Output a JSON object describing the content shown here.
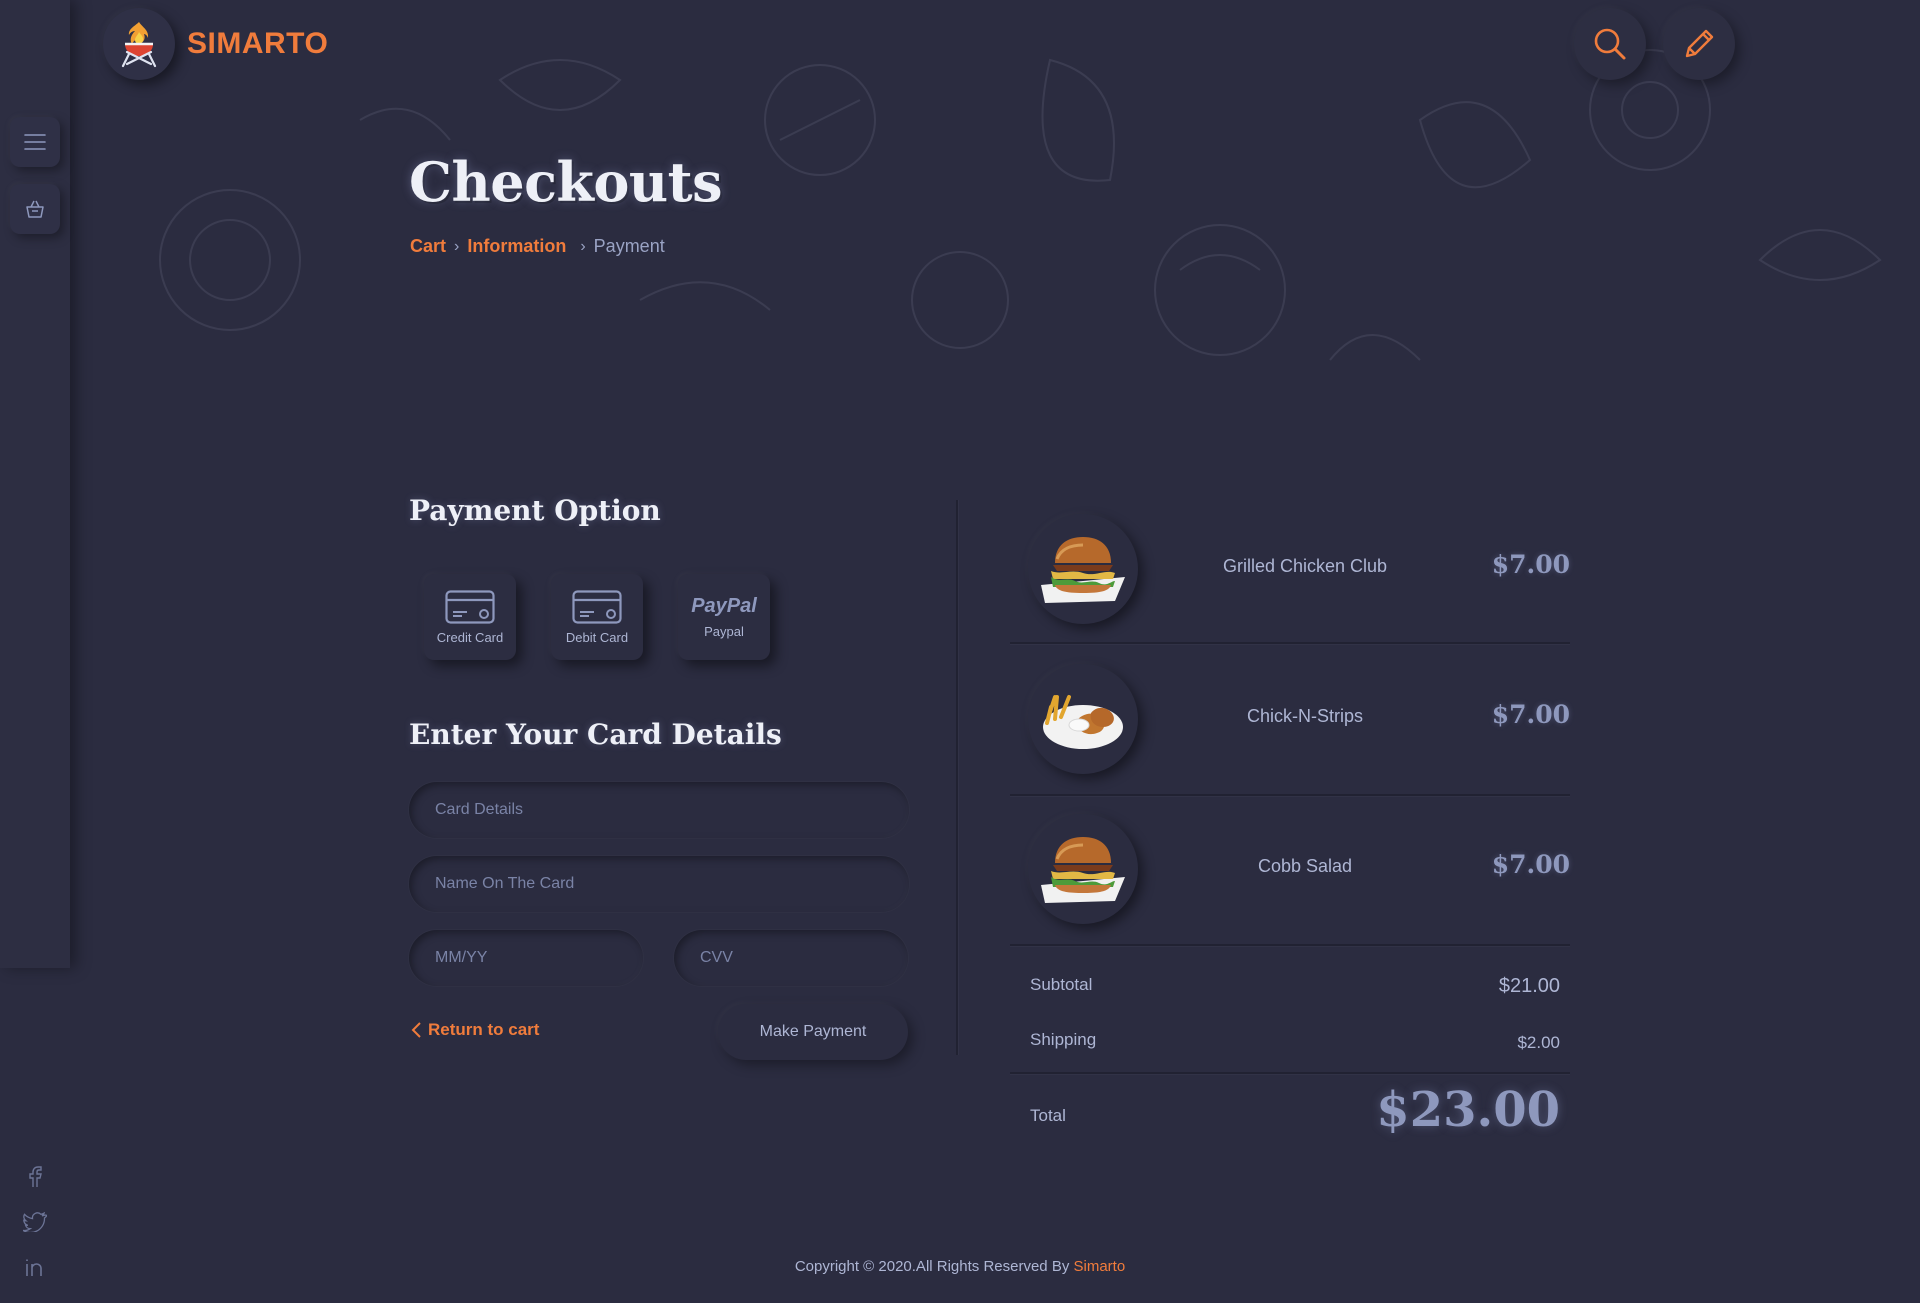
{
  "brand": {
    "name": "SIMARTO",
    "accent": "#f07c3c"
  },
  "icons": {
    "logo": "grill-flame-icon",
    "search": "search-icon",
    "edit": "pencil-icon",
    "menu": "hamburger-menu-icon",
    "cart": "shopping-basket-icon",
    "facebook": "facebook-icon",
    "twitter": "twitter-icon",
    "linkedin": "linkedin-icon",
    "credit_card": "credit-card-icon",
    "debit_card": "debit-card-icon",
    "paypal": "paypal-logo",
    "back": "chevron-left-icon"
  },
  "page": {
    "title": "Checkouts",
    "breadcrumb": {
      "cart": "Cart",
      "information": "Information",
      "payment": "Payment"
    }
  },
  "payment": {
    "heading": "Payment Option",
    "options": [
      {
        "label": "Credit Card"
      },
      {
        "label": "Debit Card"
      },
      {
        "label": "Paypal",
        "logo_text": "PayPal"
      }
    ]
  },
  "card_form": {
    "heading": "Enter Your Card Details",
    "card_details_placeholder": "Card Details",
    "name_placeholder": "Name On The Card",
    "expiry_placeholder": "MM/YY",
    "cvv_placeholder": "CVV",
    "return_label": "Return to cart",
    "submit_label": "Make Payment"
  },
  "order": {
    "items": [
      {
        "name": "Grilled Chicken Club",
        "price": "$7.00",
        "image": "burger"
      },
      {
        "name": "Chick-N-Strips",
        "price": "$7.00",
        "image": "chicken-strips"
      },
      {
        "name": "Cobb Salad",
        "price": "$7.00",
        "image": "burger"
      }
    ],
    "subtotal_label": "Subtotal",
    "subtotal": "$21.00",
    "shipping_label": "Shipping",
    "shipping": "$2.00",
    "total_label": "Total",
    "total": "$23.00"
  },
  "footer": {
    "text": "Copyright © 2020.All Rights Reserved By",
    "brand": "Simarto"
  }
}
